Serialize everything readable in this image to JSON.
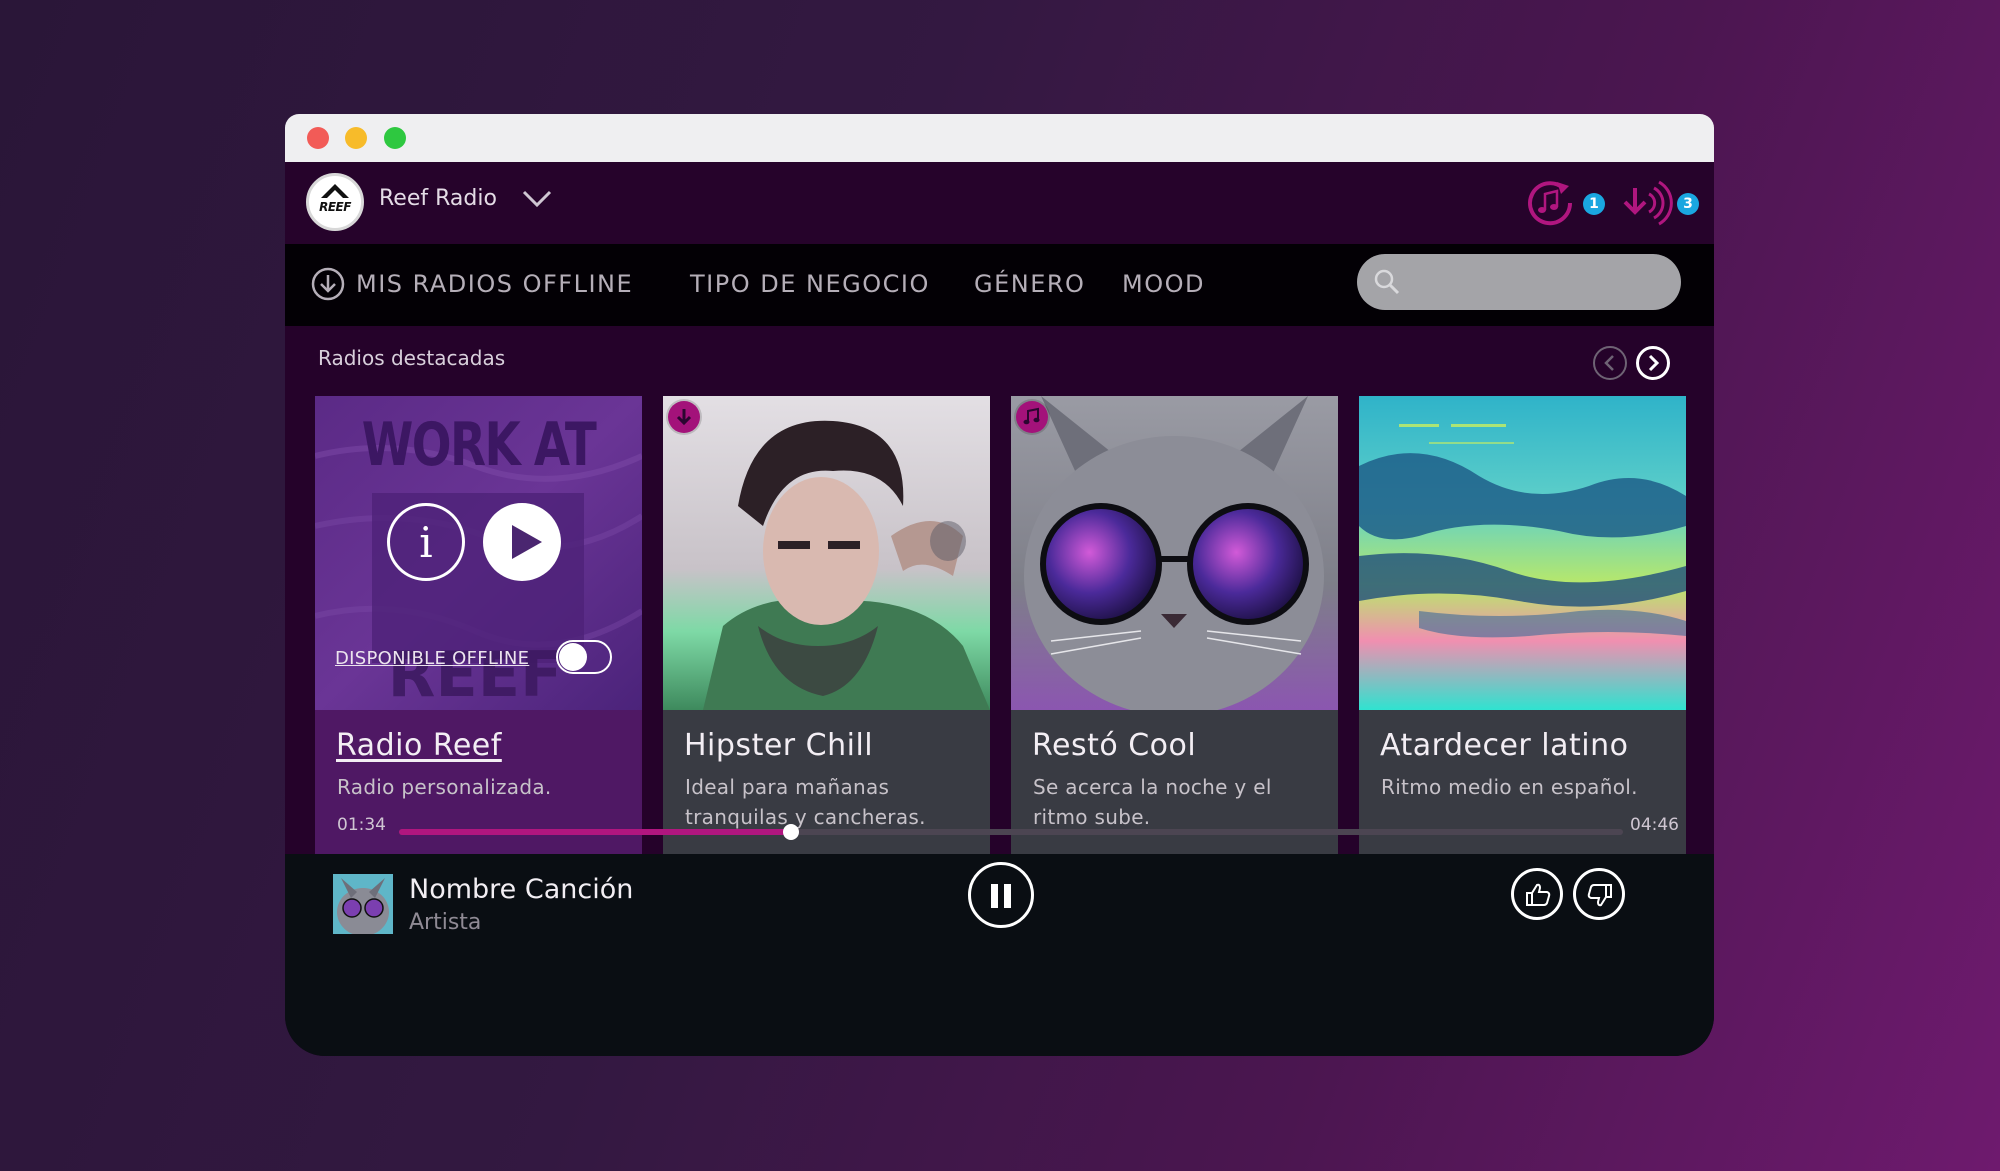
{
  "window": {
    "controls": [
      "close",
      "minimize",
      "maximize"
    ]
  },
  "topbar": {
    "logo_text": "REEF",
    "station_title": "Reef Radio",
    "badges": [
      {
        "icon": "music-sync-icon",
        "count": "1"
      },
      {
        "icon": "offline-download-icon",
        "count": "3"
      }
    ]
  },
  "nav": {
    "offline": "MIS RADIOS OFFLINE",
    "business_type": "TIPO DE NEGOCIO",
    "genre": "GÉNERO",
    "mood": "MOOD",
    "search_placeholder": ""
  },
  "featured": {
    "title": "Radios destacadas",
    "cards": [
      {
        "name": "Radio Reef",
        "desc": "Radio personalizada.",
        "image_text": "WORK AT",
        "offline_label": "DISPONIBLE OFFLINE",
        "offline_enabled": false,
        "active": true
      },
      {
        "name": "Hipster Chill",
        "desc": "Ideal para mañanas tranquilas y cancheras.",
        "badge": "download-icon"
      },
      {
        "name": "Restó Cool",
        "desc": "Se acerca la noche y el ritmo sube.",
        "badge": "music-note-icon"
      },
      {
        "name": "Atardecer latino",
        "desc": "Ritmo medio en español."
      }
    ]
  },
  "player": {
    "elapsed": "01:34",
    "duration": "04:46",
    "progress": 0.32,
    "song": "Nombre Canción",
    "artist": "Artista",
    "state": "playing"
  },
  "colors": {
    "accent": "#b0167f",
    "badge_blue": "#1aa7e0",
    "card_active": "#4f1864",
    "card_default": "#393b43"
  }
}
